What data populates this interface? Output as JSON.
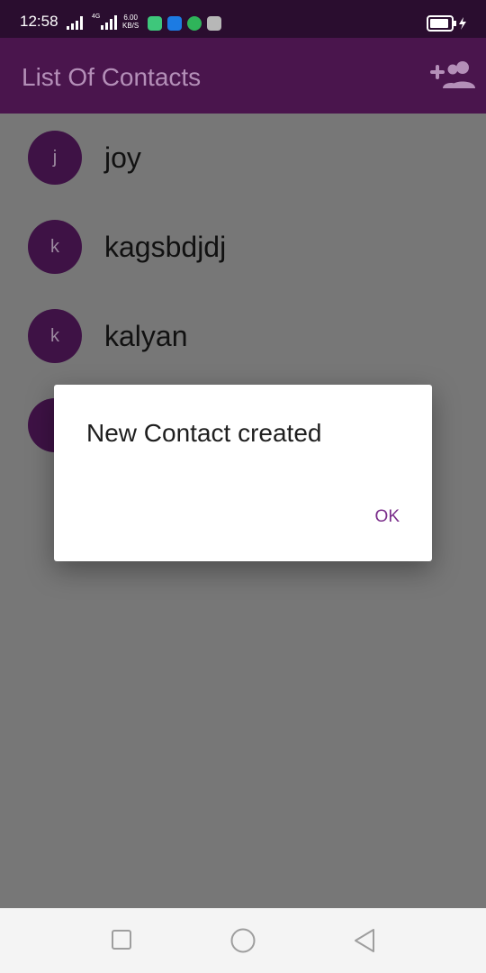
{
  "status_bar": {
    "time": "12:58",
    "network_type": "4G",
    "speed_value": "6.00",
    "speed_unit": "KB/S"
  },
  "app_bar": {
    "title": "List Of Contacts",
    "action_icon": "add-contact-icon"
  },
  "contacts": [
    {
      "initial": "j",
      "name": "joy"
    },
    {
      "initial": "k",
      "name": "kagsbdjdj"
    },
    {
      "initial": "k",
      "name": "kalyan"
    },
    {
      "initial": "",
      "name": ""
    }
  ],
  "dialog": {
    "message": "New Contact created",
    "ok_label": "OK"
  },
  "colors": {
    "status_bar": "#2a0d2f",
    "app_bar": "#4a154d",
    "avatar": "#3e1245",
    "accent": "#7a2d8a",
    "scrim_background": "#777777"
  }
}
